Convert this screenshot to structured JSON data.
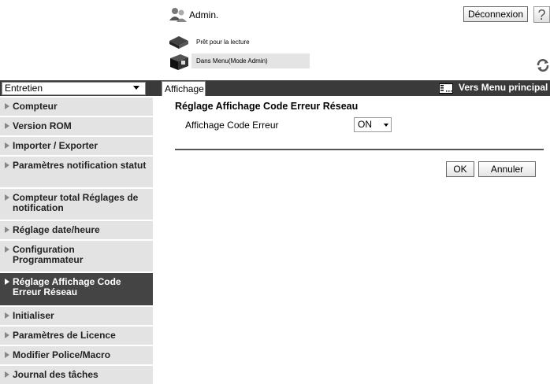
{
  "header": {
    "user_label": "Admin.",
    "logout_label": "Déconnexion",
    "help_label": "?",
    "status_ready": "Prêt pour la lecture",
    "status_mode": "Dans Menu(Mode Admin)"
  },
  "nav": {
    "menu_select_value": "Entretien",
    "tab_label": "Affichage",
    "main_menu_label": "Vers Menu principal"
  },
  "sidebar": {
    "items": [
      {
        "label": "Compteur"
      },
      {
        "label": "Version ROM"
      },
      {
        "label": "Importer / Exporter"
      },
      {
        "label": "Paramètres notification statut"
      },
      {
        "label": "Compteur total Réglages de notification"
      },
      {
        "label": "Réglage date/heure"
      },
      {
        "label": "Configuration Programmateur"
      },
      {
        "label": "Réglage Affichage Code Erreur Réseau"
      },
      {
        "label": "Initialiser"
      },
      {
        "label": "Paramètres de Licence"
      },
      {
        "label": "Modifier Police/Macro"
      },
      {
        "label": "Journal des tâches"
      }
    ],
    "active_index": 7
  },
  "main": {
    "title": "Réglage Affichage Code Erreur Réseau",
    "setting_label": "Affichage Code Erreur",
    "setting_value": "ON",
    "ok_label": "OK",
    "cancel_label": "Annuler"
  },
  "colors": {
    "nav_bar": "#3a3a3a",
    "sidebar_item": "#e3e3e3",
    "sidebar_active": "#444444"
  }
}
